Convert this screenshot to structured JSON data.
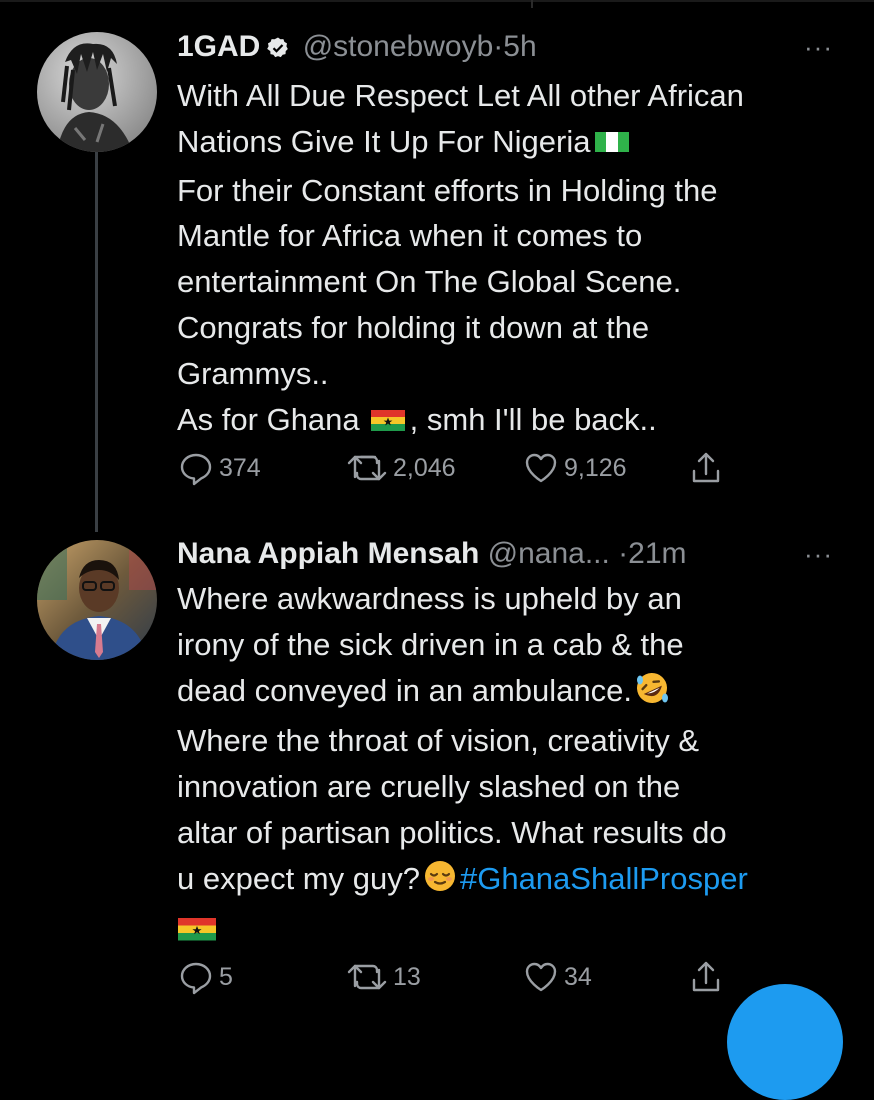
{
  "tweets": [
    {
      "name": "1GAD",
      "handle": "@stonebwoyb",
      "dot": "·",
      "time": "5h",
      "verified": true,
      "more": "···",
      "lines": [
        "With All Due Respect Let All other African",
        "Nations  Give It Up For Nigeria",
        "For their Constant efforts in Holding the",
        "Mantle for Africa when it comes to",
        "entertainment On The Global Scene.",
        "Congrats for holding it down at the",
        "Grammys..",
        "As for Ghana",
        ", smh I'll be back.."
      ],
      "flags": [
        "nigeria-flag",
        "ghana-flag"
      ],
      "stats": {
        "replies": "374",
        "retweets": "2,046",
        "likes": "9,126"
      }
    },
    {
      "name": "Nana Appiah Mensah",
      "handle": "@nana...",
      "dot": "·",
      "time": "21m",
      "verified": false,
      "more": "···",
      "lines": [
        "Where awkwardness is upheld by an",
        "irony of the sick driven in a cab & the",
        "dead conveyed in an ambulance.",
        "Where the throat of vision, creativity &",
        "innovation are cruelly slashed on the",
        "altar of partisan politics. What results do",
        "u expect my guy?",
        "#GhanaShallProsper"
      ],
      "emojis": [
        "rofl-emoji",
        "relieved-emoji"
      ],
      "flags": [
        "ghana-flag"
      ],
      "stats": {
        "replies": "5",
        "retweets": "13",
        "likes": "34"
      }
    }
  ],
  "colors": {
    "background": "#000000",
    "text": "#e7e9ea",
    "muted": "#8b8f94",
    "accent": "#1d9bf0",
    "thread_line": "#3a3f44"
  },
  "icons": [
    "reply-icon",
    "retweet-icon",
    "like-icon",
    "share-icon",
    "verified-badge-icon",
    "more-options-icon"
  ]
}
